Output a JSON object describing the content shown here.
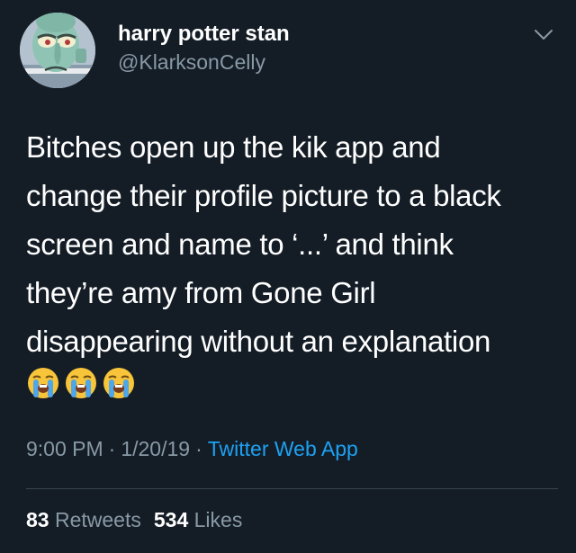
{
  "user": {
    "display_name": "harry potter stan",
    "handle": "@KlarksonCelly",
    "avatar_icon": "squidward-avatar"
  },
  "tweet": {
    "lines": [
      "Bitches open up the kik app and",
      "change their profile picture to a black",
      "screen and name to ‘...’ and think",
      "they’re amy from Gone Girl",
      "disappearing without an explanation"
    ],
    "emojis": [
      "loudly-crying-face",
      "loudly-crying-face",
      "loudly-crying-face"
    ]
  },
  "meta": {
    "time": "9:00 PM",
    "separator": "·",
    "date": "1/20/19",
    "source": "Twitter Web App"
  },
  "stats": {
    "retweets_count": "83",
    "retweets_label": "Retweets",
    "likes_count": "534",
    "likes_label": "Likes"
  },
  "colors": {
    "background": "#141d26",
    "text": "#ffffff",
    "secondary": "#8899a6",
    "link": "#1da1f2",
    "divider": "#38444d"
  }
}
